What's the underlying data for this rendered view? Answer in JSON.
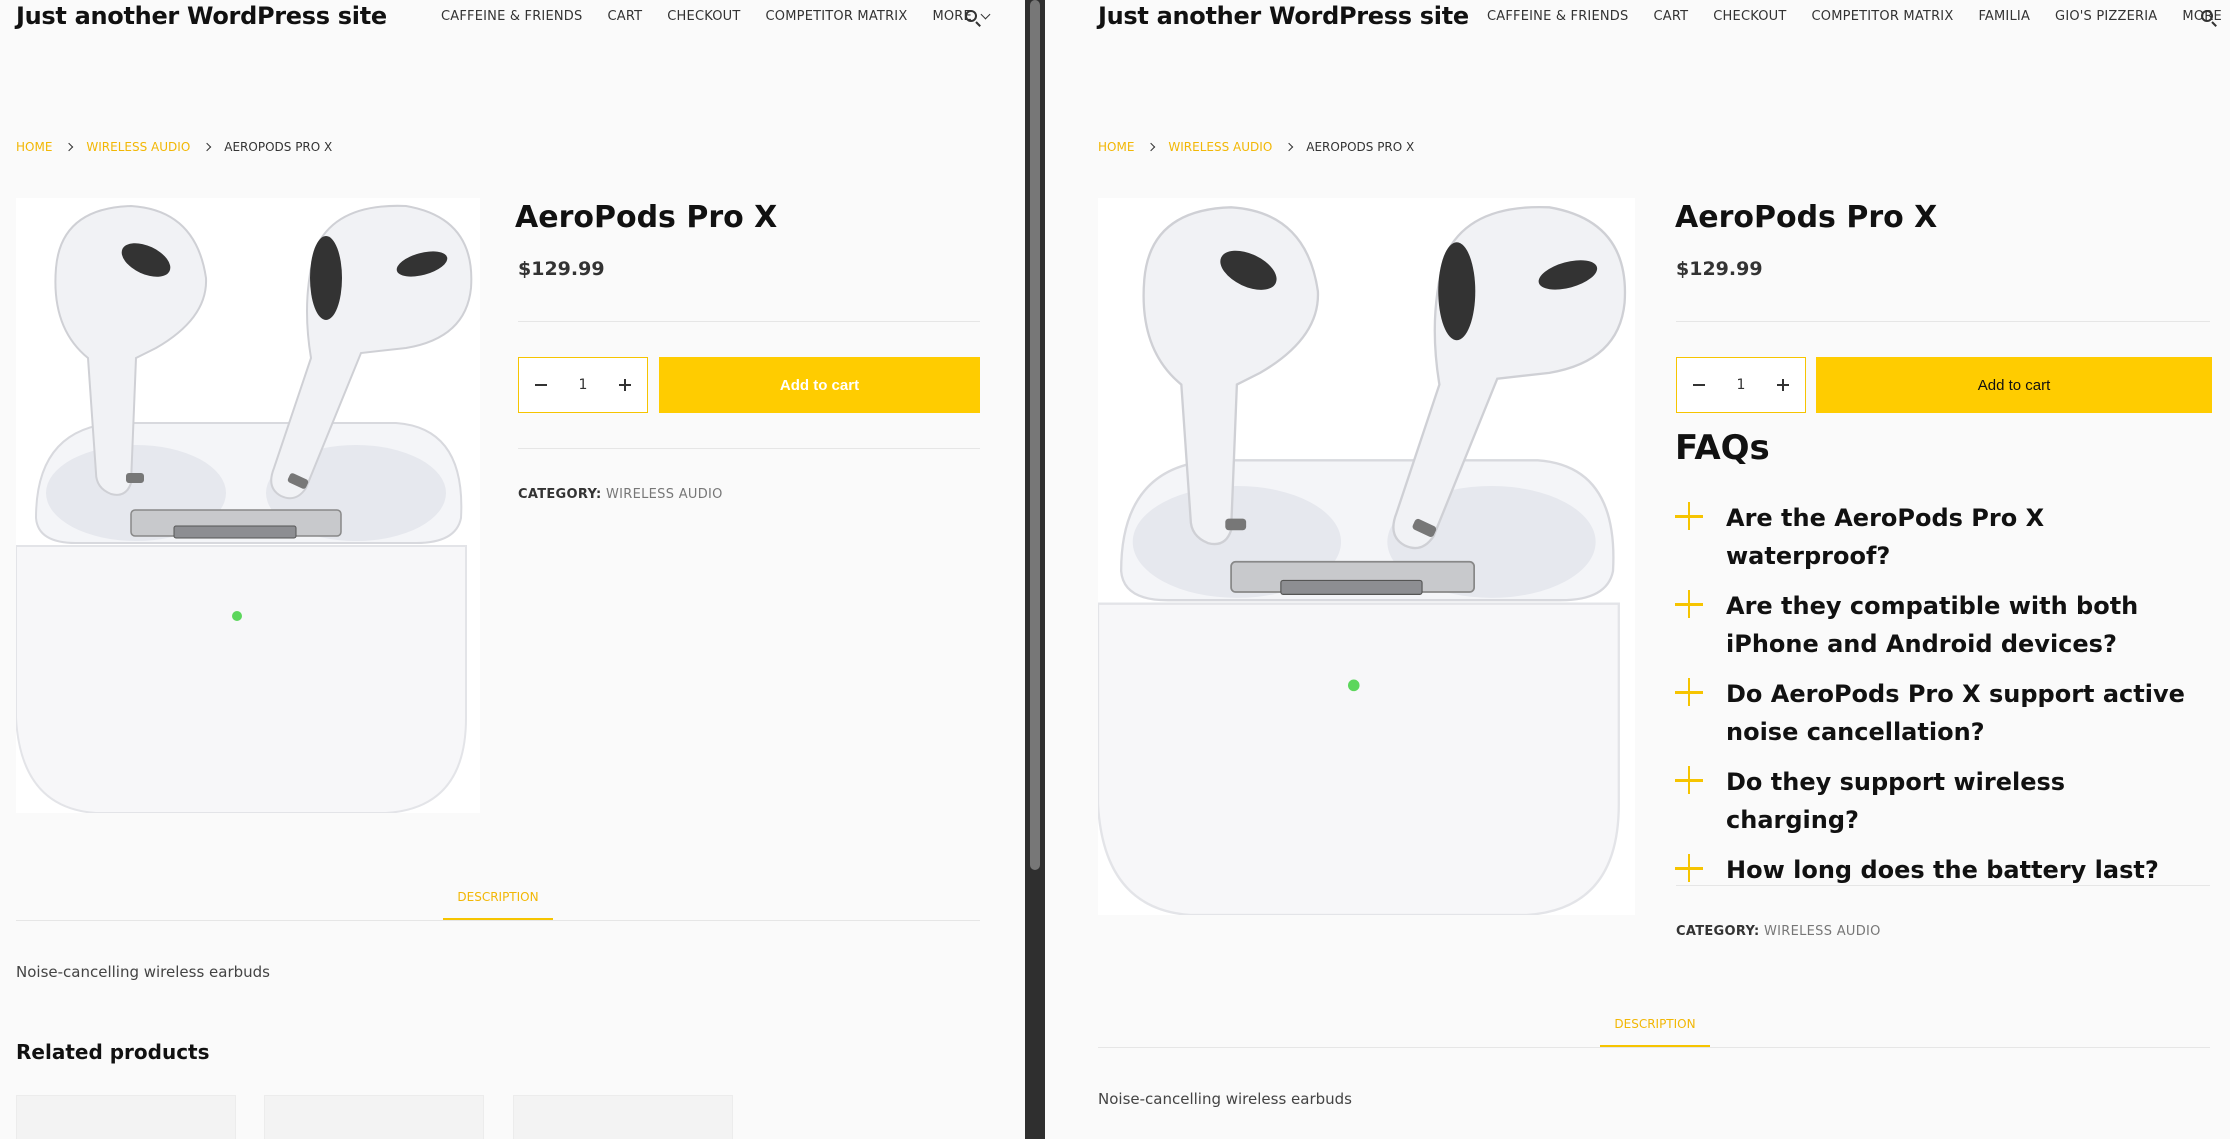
{
  "site_title": "Just another WordPress site",
  "left_window": {
    "nav": [
      "CAFFEINE & FRIENDS",
      "CART",
      "CHECKOUT",
      "COMPETITOR MATRIX"
    ],
    "nav_more": "MORE"
  },
  "right_window": {
    "nav": [
      "CAFFEINE & FRIENDS",
      "CART",
      "CHECKOUT",
      "COMPETITOR MATRIX",
      "FAMILIA",
      "GIO'S PIZZERIA"
    ],
    "nav_more": "MORE"
  },
  "breadcrumb": {
    "home": "HOME",
    "category": "WIRELESS AUDIO",
    "current": "AEROPODS PRO X"
  },
  "product": {
    "title": "AeroPods Pro X",
    "price": "$129.99",
    "quantity": "1",
    "add_to_cart": "Add to cart",
    "category_label": "CATEGORY:",
    "category_value": "WIRELESS AUDIO",
    "description_tab": "DESCRIPTION",
    "description": "Noise-cancelling wireless earbuds"
  },
  "related_products_title": "Related products",
  "faq": {
    "title": "FAQs",
    "items": [
      "Are the AeroPods Pro X waterproof?",
      "Are they compatible with both iPhone and Android devices?",
      "Do AeroPods Pro X support active noise cancellation?",
      "Do they support wireless charging?",
      "How long does the battery last?"
    ]
  },
  "colors": {
    "accent": "#ffcc00",
    "link": "#f2b705",
    "led": "#5cd65c"
  },
  "icons": {
    "search": "search-icon",
    "more": "chevron-down-icon",
    "breadcrumb_separator": "chevron-right-icon",
    "qty_minus": "minus-icon",
    "qty_plus": "plus-icon",
    "faq_toggle": "plus-icon"
  }
}
